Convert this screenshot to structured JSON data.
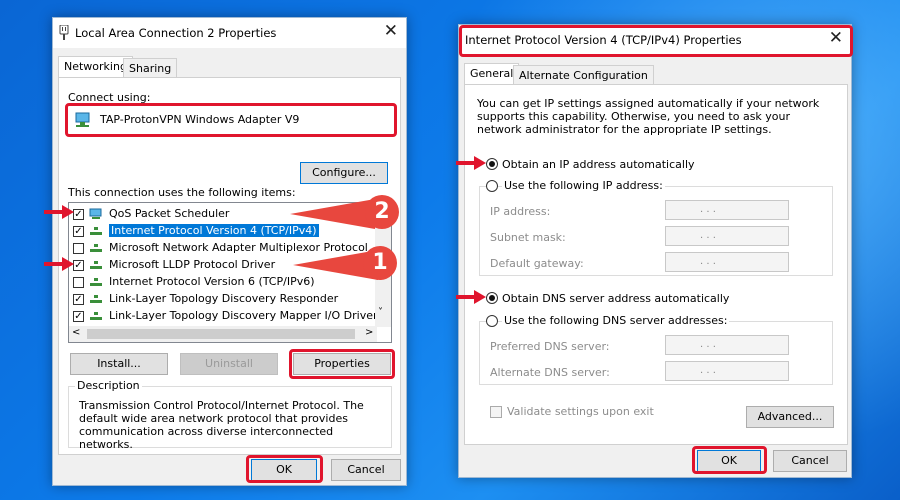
{
  "left_dialog": {
    "title": "Local Area Connection 2 Properties",
    "tabs": [
      "Networking",
      "Sharing"
    ],
    "connect_using_label": "Connect using:",
    "adapter_name": "TAP-ProtonVPN Windows Adapter V9",
    "configure_label": "Configure...",
    "items_label": "This connection uses the following items:",
    "items": [
      {
        "label": "QoS Packet Scheduler",
        "checked": true
      },
      {
        "label": "Internet Protocol Version 4 (TCP/IPv4)",
        "checked": true
      },
      {
        "label": "Microsoft Network Adapter Multiplexor Protocol",
        "checked": false
      },
      {
        "label": "Microsoft LLDP Protocol Driver",
        "checked": true
      },
      {
        "label": "Internet Protocol Version 6 (TCP/IPv6)",
        "checked": false
      },
      {
        "label": "Link-Layer Topology Discovery Responder",
        "checked": true
      },
      {
        "label": "Link-Layer Topology Discovery Mapper I/O Driver",
        "checked": true
      }
    ],
    "install_label": "Install...",
    "uninstall_label": "Uninstall",
    "properties_label": "Properties",
    "description_title": "Description",
    "description_text": "Transmission Control Protocol/Internet Protocol. The default wide area network protocol that provides communication across diverse interconnected networks.",
    "ok_label": "OK",
    "cancel_label": "Cancel"
  },
  "right_dialog": {
    "title": "Internet Protocol Version 4 (TCP/IPv4) Properties",
    "tabs": [
      "General",
      "Alternate Configuration"
    ],
    "intro_text": "You can get IP settings assigned automatically if your network supports this capability. Otherwise, you need to ask your network administrator for the appropriate IP settings.",
    "obtain_ip_auto": "Obtain an IP address automatically",
    "use_following_ip": "Use the following IP address:",
    "ip_address_label": "IP address:",
    "subnet_mask_label": "Subnet mask:",
    "default_gateway_label": "Default gateway:",
    "obtain_dns_auto": "Obtain DNS server address automatically",
    "use_following_dns": "Use the following DNS server addresses:",
    "preferred_dns_label": "Preferred DNS server:",
    "alternate_dns_label": "Alternate DNS server:",
    "validate_label": "Validate settings upon exit",
    "advanced_label": "Advanced...",
    "ok_label": "OK",
    "cancel_label": "Cancel",
    "ip_dots": ".   .   ."
  },
  "callouts": {
    "first": "1",
    "second": "2"
  },
  "colors": {
    "highlight": "#e0152d",
    "callout": "#e8473e",
    "selection": "#0078d7"
  }
}
